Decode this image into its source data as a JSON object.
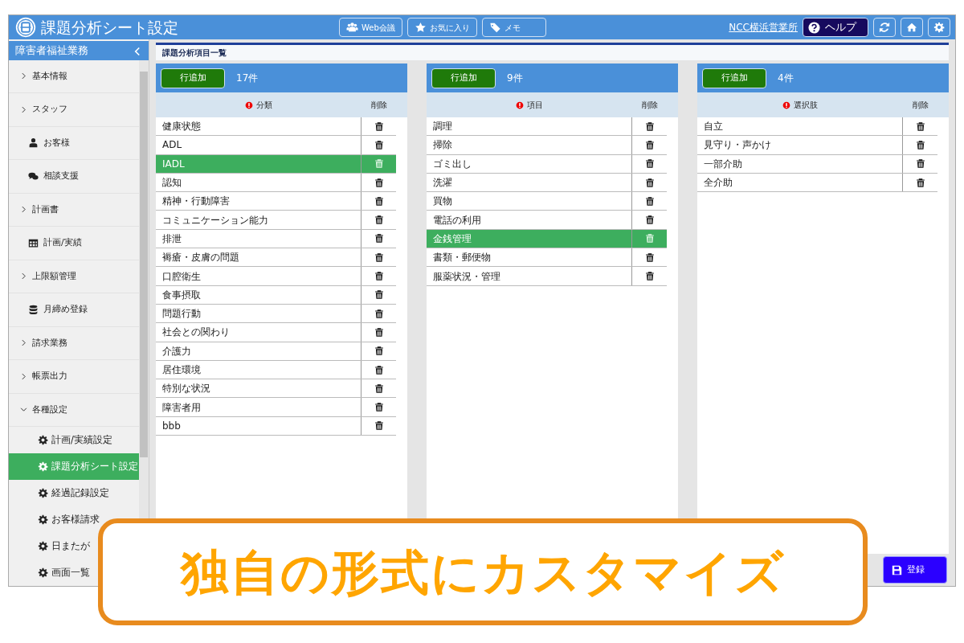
{
  "window": {
    "title": "課題分析シート設定"
  },
  "header_buttons": [
    {
      "kind": "meeting",
      "label": "Web会議"
    },
    {
      "kind": "favorite",
      "label": "お気に入り"
    },
    {
      "kind": "memo",
      "label": "メモ"
    }
  ],
  "office_link": "NCC横浜営業所",
  "help_button": "ヘルプ",
  "sidebar": {
    "title": "障害者福祉業務",
    "items": [
      {
        "kind": "group",
        "label": "基本情報",
        "expanded": false
      },
      {
        "kind": "group",
        "label": "スタッフ",
        "expanded": false
      },
      {
        "kind": "customer",
        "label": "お客様"
      },
      {
        "kind": "consult",
        "label": "相談支援"
      },
      {
        "kind": "group",
        "label": "計画書",
        "expanded": false
      },
      {
        "kind": "grid",
        "label": "計画/実績"
      },
      {
        "kind": "group",
        "label": "上限額管理",
        "expanded": false
      },
      {
        "kind": "database",
        "label": "月締め登録"
      },
      {
        "kind": "group",
        "label": "請求業務",
        "expanded": false
      },
      {
        "kind": "group",
        "label": "帳票出力",
        "expanded": false
      },
      {
        "kind": "group",
        "label": "各種設定",
        "expanded": true,
        "children": [
          {
            "label": "計画/実績設定",
            "selected": false
          },
          {
            "label": "課題分析シート設定",
            "selected": true
          },
          {
            "label": "経過記録設定",
            "selected": false
          },
          {
            "label": "お客様請求",
            "selected": false
          },
          {
            "label": "日またが",
            "selected": false
          },
          {
            "label": "画面一覧",
            "selected": false
          }
        ]
      }
    ]
  },
  "section_title": "課題分析項目一覧",
  "panels": [
    {
      "add_button": "行追加",
      "count": "17件",
      "column": "分類",
      "delete_column": "削除",
      "rows": [
        {
          "label": "健康状態",
          "selected": false
        },
        {
          "label": "ADL",
          "selected": false
        },
        {
          "label": "IADL",
          "selected": true
        },
        {
          "label": "認知",
          "selected": false
        },
        {
          "label": "精神・行動障害",
          "selected": false
        },
        {
          "label": "コミュニケーション能力",
          "selected": false
        },
        {
          "label": "排泄",
          "selected": false
        },
        {
          "label": "褥瘡・皮膚の問題",
          "selected": false
        },
        {
          "label": "口腔衛生",
          "selected": false
        },
        {
          "label": "食事摂取",
          "selected": false
        },
        {
          "label": "問題行動",
          "selected": false
        },
        {
          "label": "社会との関わり",
          "selected": false
        },
        {
          "label": "介護力",
          "selected": false
        },
        {
          "label": "居住環境",
          "selected": false
        },
        {
          "label": "特別な状況",
          "selected": false
        },
        {
          "label": "障害者用",
          "selected": false
        },
        {
          "label": "bbb",
          "selected": false
        }
      ]
    },
    {
      "add_button": "行追加",
      "count": "9件",
      "column": "項目",
      "delete_column": "削除",
      "rows": [
        {
          "label": "調理",
          "selected": false
        },
        {
          "label": "掃除",
          "selected": false
        },
        {
          "label": "ゴミ出し",
          "selected": false
        },
        {
          "label": "洗濯",
          "selected": false
        },
        {
          "label": "買物",
          "selected": false
        },
        {
          "label": "電話の利用",
          "selected": false
        },
        {
          "label": "金銭管理",
          "selected": true
        },
        {
          "label": "書類・郵便物",
          "selected": false
        },
        {
          "label": "服薬状況・管理",
          "selected": false
        }
      ]
    },
    {
      "add_button": "行追加",
      "count": "4件",
      "column": "選択肢",
      "delete_column": "削除",
      "rows": [
        {
          "label": "自立",
          "selected": false
        },
        {
          "label": "見守り・声かけ",
          "selected": false
        },
        {
          "label": "一部介助",
          "selected": false
        },
        {
          "label": "全介助",
          "selected": false
        }
      ]
    }
  ],
  "save_button": "登録",
  "banner": "独自の形式にカスタマイズ"
}
